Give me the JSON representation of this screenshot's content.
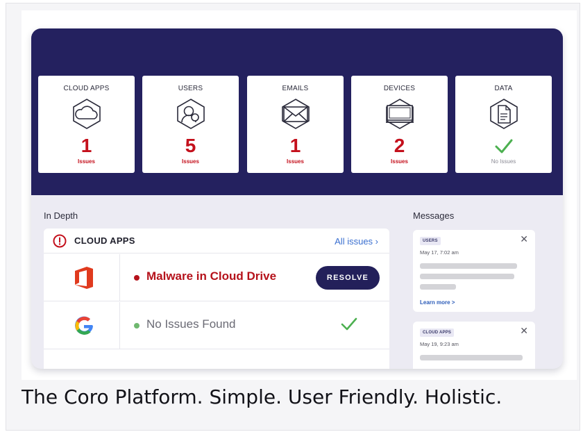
{
  "categories": [
    {
      "title": "CLOUD APPS",
      "count": "1",
      "status": "Issues",
      "icon": "cloud-icon",
      "has_issues": true
    },
    {
      "title": "USERS",
      "count": "5",
      "status": "Issues",
      "icon": "user-icon",
      "has_issues": true
    },
    {
      "title": "EMAILS",
      "count": "1",
      "status": "Issues",
      "icon": "envelope-icon",
      "has_issues": true
    },
    {
      "title": "DEVICES",
      "count": "2",
      "status": "Issues",
      "icon": "monitor-icon",
      "has_issues": true
    },
    {
      "title": "DATA",
      "count": "",
      "status": "No Issues",
      "icon": "document-icon",
      "has_issues": false
    }
  ],
  "in_depth": {
    "label": "In Depth",
    "panel_title": "CLOUD APPS",
    "all_issues": "All issues ›",
    "rows": [
      {
        "app": "office-icon",
        "text": "Malware in Cloud Drive",
        "status": "issue",
        "action": "RESOLVE"
      },
      {
        "app": "google-icon",
        "text": "No Issues Found",
        "status": "ok"
      }
    ]
  },
  "messages": {
    "label": "Messages",
    "cards": [
      {
        "tag": "USERS",
        "date": "May 17, 7:02 am",
        "link": "Learn more >"
      },
      {
        "tag": "CLOUD APPS",
        "date": "May 19, 9:23 am"
      }
    ]
  },
  "caption": "The Coro Platform. Simple. User Friendly. Holistic.",
  "colors": {
    "header": "#24215f",
    "issue": "#c4101c",
    "ok": "#4cb050",
    "link": "#3a6fd0"
  }
}
